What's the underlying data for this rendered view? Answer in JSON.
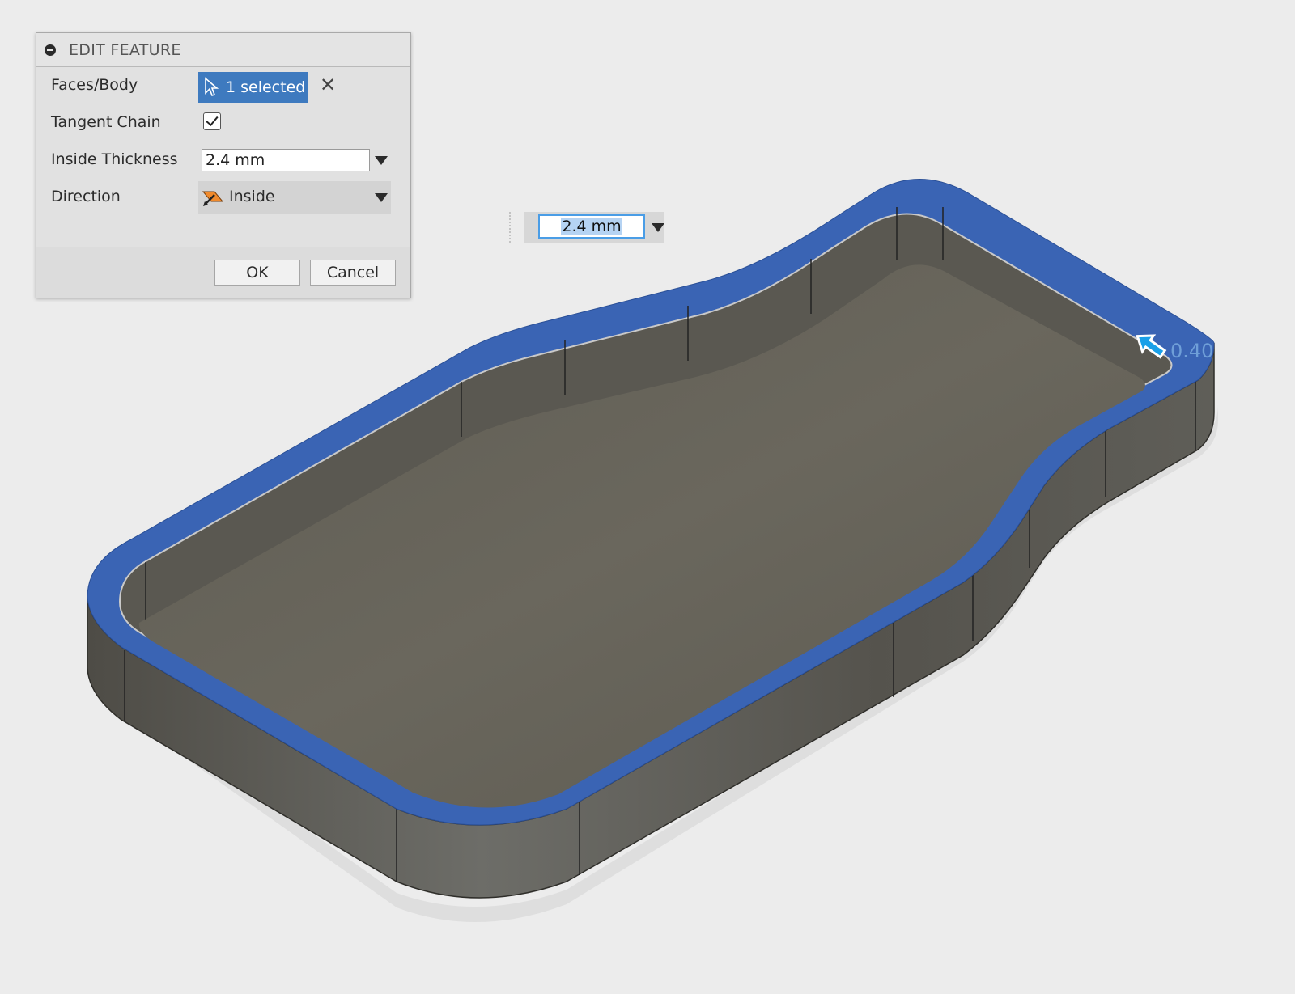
{
  "dialog": {
    "title": "EDIT FEATURE",
    "faces_body": {
      "label": "Faces/Body",
      "selection": "1 selected"
    },
    "tangent_chain": {
      "label": "Tangent Chain",
      "checked": true
    },
    "inside_thickness": {
      "label": "Inside Thickness",
      "value": "2.4 mm"
    },
    "direction": {
      "label": "Direction",
      "value": "Inside"
    },
    "ok_label": "OK",
    "cancel_label": "Cancel"
  },
  "canvas_input": {
    "value": "2.4 mm"
  },
  "viewport": {
    "angle_readout": "0.40"
  },
  "colors": {
    "selection_blue": "#3a64b4",
    "body_gray": "#67645a",
    "button_blue": "#3e7abf"
  }
}
